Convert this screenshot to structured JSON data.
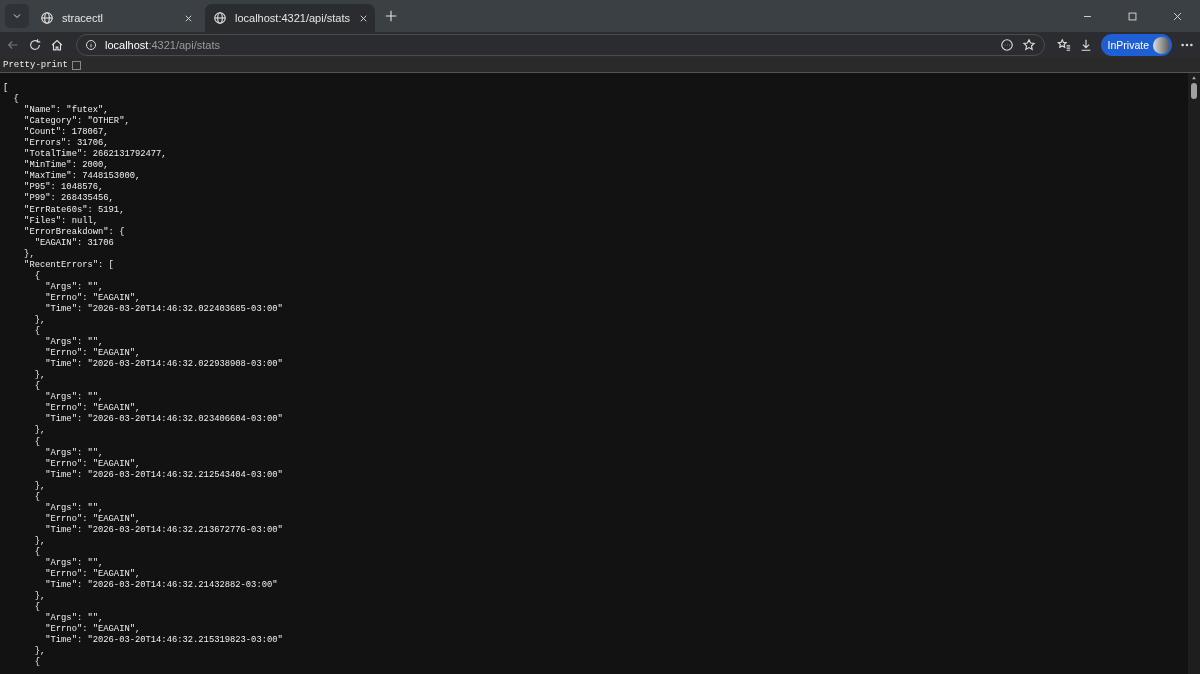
{
  "tabs": [
    {
      "title": "stracectl",
      "selected": false
    },
    {
      "title": "localhost:4321/api/stats",
      "selected": true
    }
  ],
  "address": {
    "host": "localhost",
    "path": ":4321/api/stats"
  },
  "profile": {
    "label": "InPrivate"
  },
  "pretty_print": {
    "label": "Pretty-print",
    "checked": false
  },
  "lines": [
    "[",
    "  {",
    "    \"Name\": \"futex\",",
    "    \"Category\": \"OTHER\",",
    "    \"Count\": 178067,",
    "    \"Errors\": 31706,",
    "    \"TotalTime\": 2662131792477,",
    "    \"MinTime\": 2000,",
    "    \"MaxTime\": 7448153000,",
    "    \"P95\": 1048576,",
    "    \"P99\": 268435456,",
    "    \"ErrRate60s\": 5191,",
    "    \"Files\": null,",
    "    \"ErrorBreakdown\": {",
    "      \"EAGAIN\": 31706",
    "    },",
    "    \"RecentErrors\": [",
    "      {",
    "        \"Args\": \"\",",
    "        \"Errno\": \"EAGAIN\",",
    "        \"Time\": \"2026-03-20T14:46:32.022403685-03:00\"",
    "      },",
    "      {",
    "        \"Args\": \"\",",
    "        \"Errno\": \"EAGAIN\",",
    "        \"Time\": \"2026-03-20T14:46:32.022938908-03:00\"",
    "      },",
    "      {",
    "        \"Args\": \"\",",
    "        \"Errno\": \"EAGAIN\",",
    "        \"Time\": \"2026-03-20T14:46:32.023406604-03:00\"",
    "      },",
    "      {",
    "        \"Args\": \"\",",
    "        \"Errno\": \"EAGAIN\",",
    "        \"Time\": \"2026-03-20T14:46:32.212543404-03:00\"",
    "      },",
    "      {",
    "        \"Args\": \"\",",
    "        \"Errno\": \"EAGAIN\",",
    "        \"Time\": \"2026-03-20T14:46:32.213672776-03:00\"",
    "      },",
    "      {",
    "        \"Args\": \"\",",
    "        \"Errno\": \"EAGAIN\",",
    "        \"Time\": \"2026-03-20T14:46:32.21432882-03:00\"",
    "      },",
    "      {",
    "        \"Args\": \"\",",
    "        \"Errno\": \"EAGAIN\",",
    "        \"Time\": \"2026-03-20T14:46:32.215319823-03:00\"",
    "      },",
    "      {"
  ]
}
